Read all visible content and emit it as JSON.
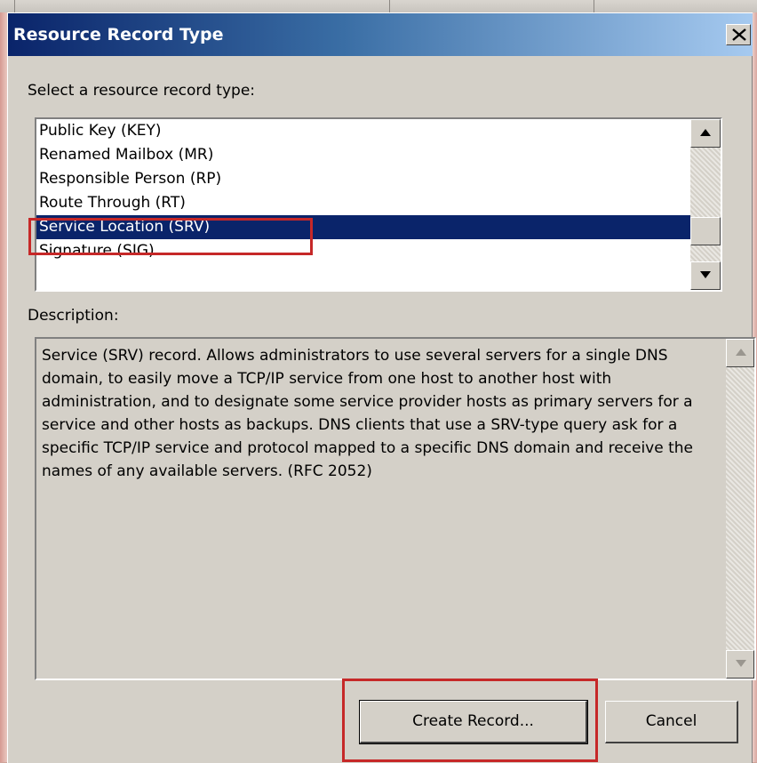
{
  "dialog": {
    "title": "Resource Record Type",
    "close_label": "×"
  },
  "list": {
    "label": "Select a resource record type:",
    "items": [
      "Public Key (KEY)",
      "Renamed Mailbox (MR)",
      "Responsible Person (RP)",
      "Route Through (RT)",
      "Service Location (SRV)",
      "Signature (SIG)"
    ],
    "selected": "Service Location (SRV)"
  },
  "description": {
    "label": "Description:",
    "text": "Service (SRV) record. Allows administrators to use several servers for a single DNS domain, to easily move a TCP/IP service from one host to another host with administration, and to designate some service provider hosts as primary servers for a service and other hosts as backups. DNS clients that use a SRV-type query ask for a specific TCP/IP service and protocol mapped to a specific DNS domain and receive the names of any available servers. (RFC 2052)"
  },
  "buttons": {
    "create": "Create Record...",
    "cancel": "Cancel"
  },
  "colors": {
    "selection": "#0a246a",
    "highlight_box": "#c62828",
    "titlebar_start": "#0a246a",
    "titlebar_end": "#a6caf0"
  }
}
